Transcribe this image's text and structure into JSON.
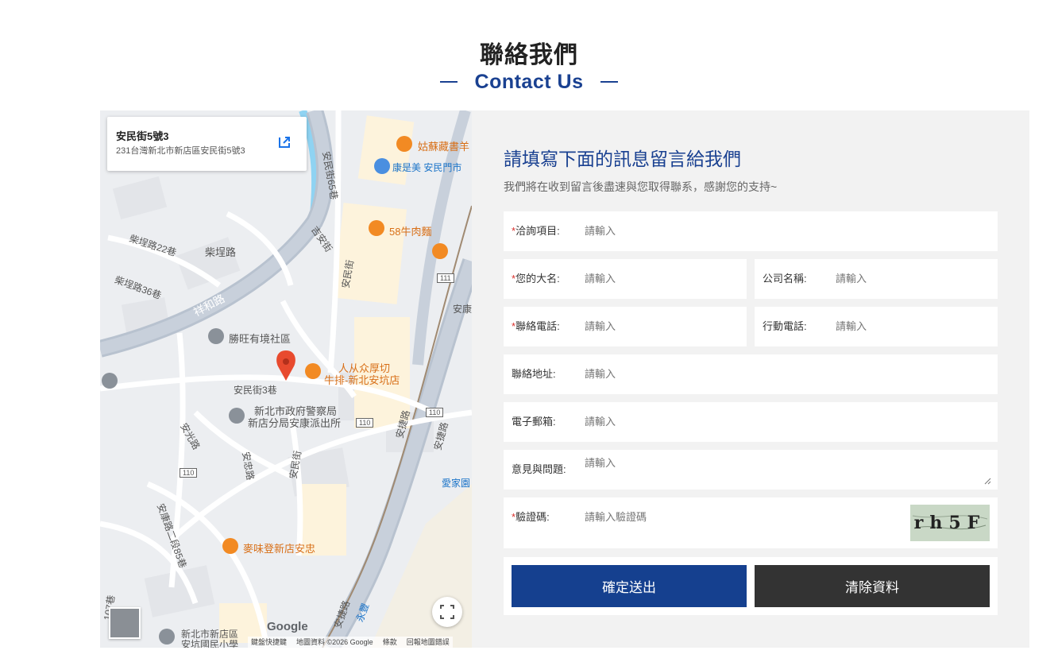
{
  "header": {
    "title_zh": "聯絡我們",
    "title_en": "Contact Us"
  },
  "map": {
    "card": {
      "title": "安民街5號3",
      "subtitle": "231台灣新北市新店區安民街5號3"
    },
    "labels": [
      {
        "text": "姑蘇藏書羊",
        "style": "orange"
      },
      {
        "text": "康是美 安民門市",
        "style": "blue"
      },
      {
        "text": "安民街65巷",
        "style": "plain"
      },
      {
        "text": "58牛肉麵",
        "style": "orange"
      },
      {
        "text": "吉安街",
        "style": "plain"
      },
      {
        "text": "柴埕路22巷",
        "style": "plain"
      },
      {
        "text": "柴埕路",
        "style": "plain"
      },
      {
        "text": "柴埕路36巷",
        "style": "plain"
      },
      {
        "text": "祥和路",
        "style": "plain"
      },
      {
        "text": "安民街",
        "style": "plain"
      },
      {
        "text": "安康",
        "style": "plain"
      },
      {
        "text": "勝旺有境社區",
        "style": "plain"
      },
      {
        "text": "人从众厚切",
        "style": "orange"
      },
      {
        "text": "牛排-新北安坑店",
        "style": "orange"
      },
      {
        "text": "安民街3巷",
        "style": "plain"
      },
      {
        "text": "新北市政府警察局",
        "style": "plain"
      },
      {
        "text": "新店分局安康派出所",
        "style": "plain"
      },
      {
        "text": "安光路",
        "style": "plain"
      },
      {
        "text": "安忠路",
        "style": "plain"
      },
      {
        "text": "安民街",
        "style": "plain"
      },
      {
        "text": "安捷路",
        "style": "plain"
      },
      {
        "text": "安捷路",
        "style": "plain"
      },
      {
        "text": "愛家園",
        "style": "blue"
      },
      {
        "text": "安康路二段85巷",
        "style": "plain"
      },
      {
        "text": "麥味登新店安忠",
        "style": "orange"
      },
      {
        "text": "安捷路",
        "style": "plain"
      },
      {
        "text": "永豐",
        "style": "blue"
      },
      {
        "text": "新北市新店區",
        "style": "plain"
      },
      {
        "text": "安坑國民小學",
        "style": "plain"
      },
      {
        "text": "107巷",
        "style": "plain"
      }
    ],
    "road_shields": [
      "111",
      "110",
      "110",
      "110"
    ],
    "google": "Google",
    "footer": [
      "鍵盤快捷鍵",
      "地圖資料 ©2026 Google",
      "條款",
      "回報地圖錯誤"
    ]
  },
  "form": {
    "title": "請填寫下面的訊息留言給我們",
    "description": "我們將在收到留言後盡速與您取得聯系，感謝您的支持~",
    "placeholder": "請輸入",
    "captcha_placeholder": "請輸入驗證碼",
    "captcha_text": "rh5F",
    "fields": {
      "inquiry": {
        "label": "洽詢項目:",
        "required": "*"
      },
      "name": {
        "label": "您的大名:",
        "required": "*"
      },
      "company": {
        "label": "公司名稱:"
      },
      "phone": {
        "label": "聯絡電話:",
        "required": "*"
      },
      "mobile": {
        "label": "行動電話:"
      },
      "address": {
        "label": "聯絡地址:"
      },
      "email": {
        "label": "電子郵箱:"
      },
      "comments": {
        "label": "意見與問題:"
      },
      "captcha": {
        "label": "驗證碼:",
        "required": "*"
      }
    },
    "submit_label": "確定送出",
    "clear_label": "清除資料"
  },
  "colors": {
    "brand_blue": "#15408f",
    "dark_button": "#333333",
    "required_red": "#d9302c",
    "panel_bg": "#f2f2f2"
  }
}
